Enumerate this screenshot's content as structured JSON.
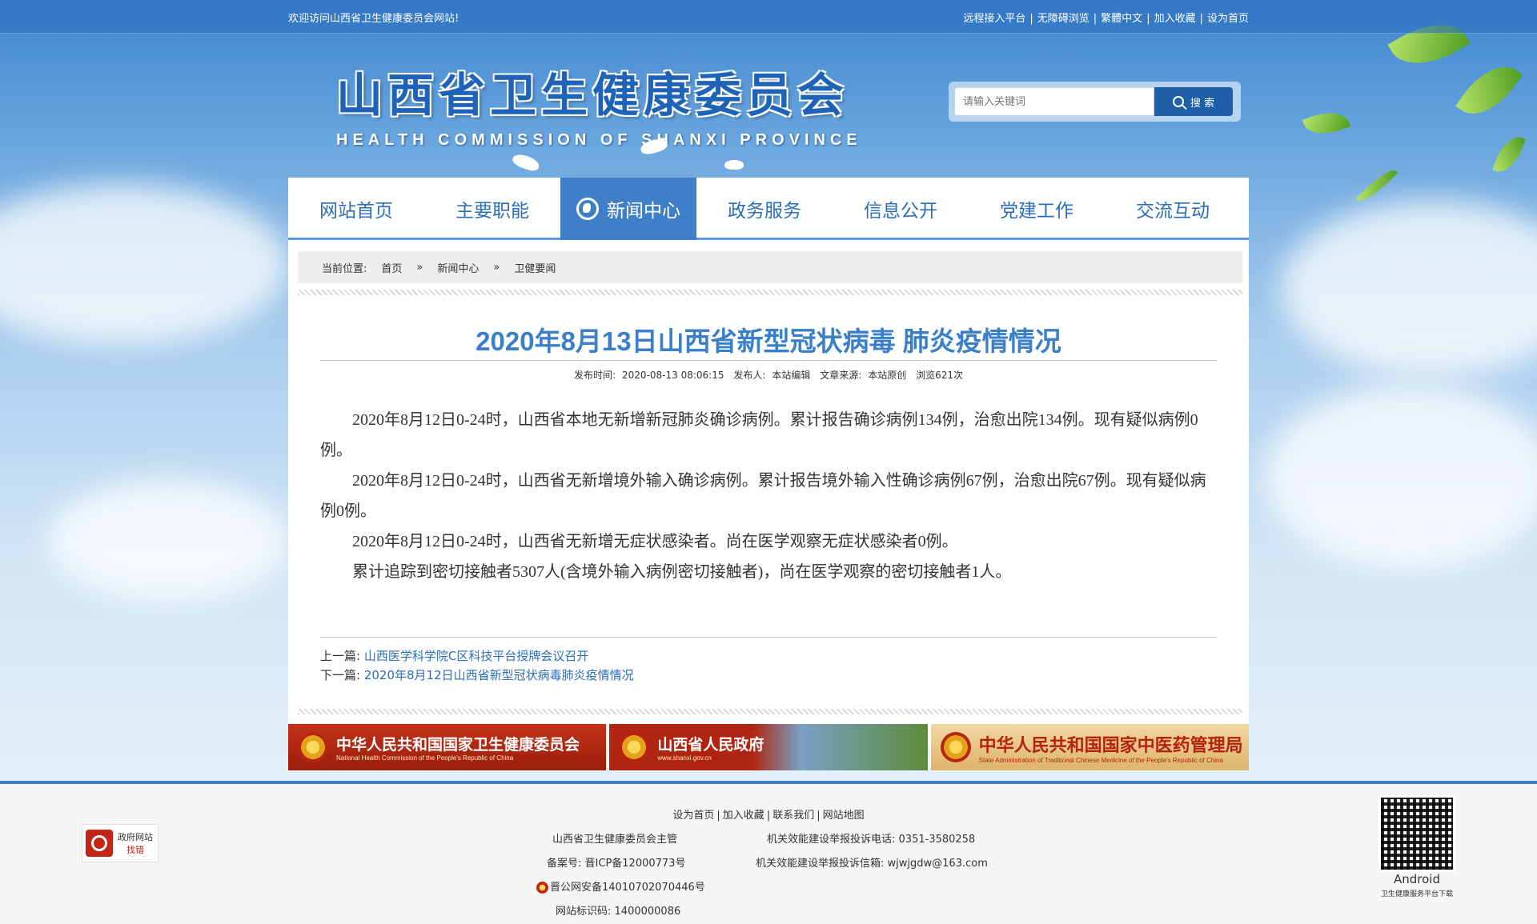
{
  "topbar": {
    "welcome": "欢迎访问山西省卫生健康委员会网站!",
    "links": [
      "远程接入平台",
      "无障碍浏览",
      "繁體中文",
      "加入收藏",
      "设为首页"
    ]
  },
  "logo": {
    "cn": "山西省卫生健康委员会",
    "en": "HEALTH COMMISSION OF SHANXI PROVINCE"
  },
  "search": {
    "placeholder": "请输入关键词",
    "button": "搜 索"
  },
  "nav": {
    "items": [
      "网站首页",
      "主要职能",
      "新闻中心",
      "政务服务",
      "信息公开",
      "党建工作",
      "交流互动"
    ],
    "active_index": 2
  },
  "breadcrumb": {
    "label": "当前位置:",
    "items": [
      "首页",
      "新闻中心",
      "卫健要闻"
    ],
    "sep": "»"
  },
  "article": {
    "title": "2020年8月13日山西省新型冠状病毒 肺炎疫情情况",
    "meta": {
      "publish_label": "发布时间:",
      "publish_time": "2020-08-13 08:06:15",
      "author_label": "发布人:",
      "author": "本站编辑",
      "source_label": "文章来源:",
      "source": "本站原创",
      "views": "浏览621次"
    },
    "paragraphs": [
      "2020年8月12日0-24时，山西省本地无新增新冠肺炎确诊病例。累计报告确诊病例134例，治愈出院134例。现有疑似病例0例。",
      "2020年8月12日0-24时，山西省无新增境外输入确诊病例。累计报告境外输入性确诊病例67例，治愈出院67例。现有疑似病例0例。",
      "2020年8月12日0-24时，山西省无新增无症状感染者。尚在医学观察无症状感染者0例。",
      "累计追踪到密切接触者5307人(含境外输入病例密切接触者)，尚在医学观察的密切接触者1人。"
    ],
    "prev_label": "上一篇:",
    "prev_title": "山西医学科学院C区科技平台授牌会议召开",
    "next_label": "下一篇:",
    "next_title": "2020年8月12日山西省新型冠状病毒肺炎疫情情况"
  },
  "banners": [
    {
      "cn": "中华人民共和国国家卫生健康委员会",
      "en": "National Health Commission of the People's Republic of China"
    },
    {
      "cn": "山西省人民政府",
      "en": "www.shanxi.gov.cn"
    },
    {
      "cn": "中华人民共和国国家中医药管理局",
      "en": "State Administration of Traditional Chinese Medicine of the People's Republic of China"
    }
  ],
  "footer": {
    "links": [
      "设为首页",
      "加入收藏",
      "联系我们",
      "网站地图"
    ],
    "host": "山西省卫生健康委员会主管",
    "icp_label": "备案号:",
    "icp": "晋ICP备12000773号",
    "police": "晋公网安备14010702070446号",
    "site_id_label": "网站标识码:",
    "site_id": "1400000086",
    "phone_label": "机关效能建设举报投诉电话:",
    "phone": "0351-3580258",
    "email_label": "机关效能建设举报投诉信箱:",
    "email": "wjwjgdw@163.com",
    "badge_line1": "政府网站",
    "badge_line2": "找错",
    "qr_caption": "Android",
    "qr_subcaption": "卫生健康服务平台下载"
  },
  "colors": {
    "brand_blue": "#3e7fc8",
    "title_blue": "#3a7fc9",
    "link_blue": "#2a6eb9"
  }
}
